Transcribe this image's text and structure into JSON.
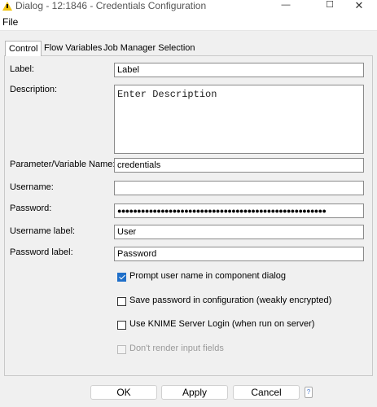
{
  "window": {
    "title": "Dialog - 12:1846 - Credentials Configuration",
    "minimize_glyph": "—",
    "maximize_glyph": "☐",
    "close_glyph": "✕"
  },
  "menu": {
    "file": "File"
  },
  "tabs": [
    {
      "label": "Control",
      "active": true
    },
    {
      "label": "Flow Variables",
      "active": false
    },
    {
      "label": "Job Manager Selection",
      "active": false
    }
  ],
  "form": {
    "label": {
      "label": "Label:",
      "value": "Label"
    },
    "description": {
      "label": "Description:",
      "value": "Enter Description"
    },
    "param_name": {
      "label": "Parameter/Variable Name:",
      "value": "credentials"
    },
    "username": {
      "label": "Username:",
      "value": ""
    },
    "password": {
      "label": "Password:",
      "value": "●●●●●●●●●●●●●●●●●●●●●●●●●●●●●●●●●●●●●●●●●●●●●●●●●●●●●"
    },
    "username_label": {
      "label": "Username label:",
      "value": "User"
    },
    "password_label": {
      "label": "Password label:",
      "value": "Password"
    }
  },
  "checkboxes": [
    {
      "label": "Prompt user name in component dialog",
      "checked": true,
      "disabled": false
    },
    {
      "label": "Save password in configuration (weakly encrypted)",
      "checked": false,
      "disabled": false
    },
    {
      "label": "Use KNIME Server Login (when run on server)",
      "checked": false,
      "disabled": false
    },
    {
      "label": "Don't render input fields",
      "checked": false,
      "disabled": true
    }
  ],
  "buttons": {
    "ok": "OK",
    "apply": "Apply",
    "cancel": "Cancel"
  },
  "help_glyph": "?",
  "colors": {
    "accent": "#1f6fc9",
    "warning": "#f2c40f"
  }
}
